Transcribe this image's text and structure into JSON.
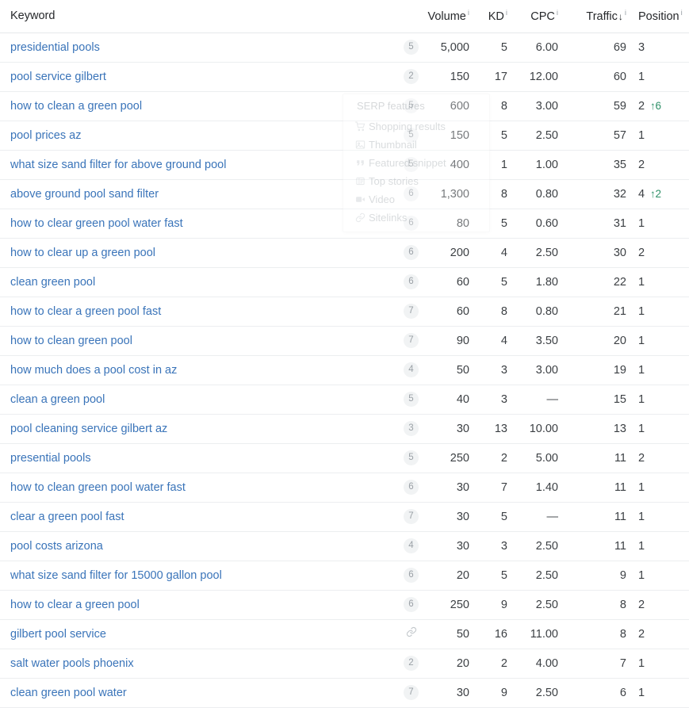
{
  "table": {
    "columns": [
      {
        "key": "keyword",
        "label": "Keyword",
        "info": false,
        "sort": ""
      },
      {
        "key": "badge",
        "label": "",
        "info": false,
        "sort": ""
      },
      {
        "key": "volume",
        "label": "Volume",
        "info": true,
        "sort": ""
      },
      {
        "key": "kd",
        "label": "KD",
        "info": true,
        "sort": ""
      },
      {
        "key": "cpc",
        "label": "CPC",
        "info": true,
        "sort": ""
      },
      {
        "key": "traffic",
        "label": "Traffic",
        "info": true,
        "sort": "↓"
      },
      {
        "key": "position",
        "label": "Position",
        "info": true,
        "sort": ""
      }
    ],
    "info_glyph": "i",
    "rows": [
      {
        "keyword": "presidential pools",
        "badge": "5",
        "badge_type": "count",
        "volume": "5,000",
        "kd": "5",
        "cpc": "6.00",
        "traffic": "69",
        "position": "3",
        "delta": ""
      },
      {
        "keyword": "pool service gilbert",
        "badge": "2",
        "badge_type": "count",
        "volume": "150",
        "kd": "17",
        "cpc": "12.00",
        "traffic": "60",
        "position": "1",
        "delta": ""
      },
      {
        "keyword": "how to clean a green pool",
        "badge": "5",
        "badge_type": "count",
        "volume": "600",
        "kd": "8",
        "cpc": "3.00",
        "traffic": "59",
        "position": "2",
        "delta": "↑6"
      },
      {
        "keyword": "pool prices az",
        "badge": "5",
        "badge_type": "count",
        "volume": "150",
        "kd": "5",
        "cpc": "2.50",
        "traffic": "57",
        "position": "1",
        "delta": ""
      },
      {
        "keyword": "what size sand filter for above ground pool",
        "badge": "5",
        "badge_type": "count",
        "volume": "400",
        "kd": "1",
        "cpc": "1.00",
        "traffic": "35",
        "position": "2",
        "delta": ""
      },
      {
        "keyword": "above ground pool sand filter",
        "badge": "6",
        "badge_type": "count",
        "volume": "1,300",
        "kd": "8",
        "cpc": "0.80",
        "traffic": "32",
        "position": "4",
        "delta": "↑2"
      },
      {
        "keyword": "how to clear green pool water fast",
        "badge": "6",
        "badge_type": "count",
        "volume": "80",
        "kd": "5",
        "cpc": "0.60",
        "traffic": "31",
        "position": "1",
        "delta": ""
      },
      {
        "keyword": "how to clear up a green pool",
        "badge": "6",
        "badge_type": "count",
        "volume": "200",
        "kd": "4",
        "cpc": "2.50",
        "traffic": "30",
        "position": "2",
        "delta": ""
      },
      {
        "keyword": "clean green pool",
        "badge": "6",
        "badge_type": "count",
        "volume": "60",
        "kd": "5",
        "cpc": "1.80",
        "traffic": "22",
        "position": "1",
        "delta": ""
      },
      {
        "keyword": "how to clear a green pool fast",
        "badge": "7",
        "badge_type": "count",
        "volume": "60",
        "kd": "8",
        "cpc": "0.80",
        "traffic": "21",
        "position": "1",
        "delta": ""
      },
      {
        "keyword": "how to clean green pool",
        "badge": "7",
        "badge_type": "count",
        "volume": "90",
        "kd": "4",
        "cpc": "3.50",
        "traffic": "20",
        "position": "1",
        "delta": ""
      },
      {
        "keyword": "how much does a pool cost in az",
        "badge": "4",
        "badge_type": "count",
        "volume": "50",
        "kd": "3",
        "cpc": "3.00",
        "traffic": "19",
        "position": "1",
        "delta": ""
      },
      {
        "keyword": "clean a green pool",
        "badge": "5",
        "badge_type": "count",
        "volume": "40",
        "kd": "3",
        "cpc": "—",
        "traffic": "15",
        "position": "1",
        "delta": ""
      },
      {
        "keyword": "pool cleaning service gilbert az",
        "badge": "3",
        "badge_type": "count",
        "volume": "30",
        "kd": "13",
        "cpc": "10.00",
        "traffic": "13",
        "position": "1",
        "delta": ""
      },
      {
        "keyword": "presential pools",
        "badge": "5",
        "badge_type": "count",
        "volume": "250",
        "kd": "2",
        "cpc": "5.00",
        "traffic": "11",
        "position": "2",
        "delta": ""
      },
      {
        "keyword": "how to clean green pool water fast",
        "badge": "6",
        "badge_type": "count",
        "volume": "30",
        "kd": "7",
        "cpc": "1.40",
        "traffic": "11",
        "position": "1",
        "delta": ""
      },
      {
        "keyword": "clear a green pool fast",
        "badge": "7",
        "badge_type": "count",
        "volume": "30",
        "kd": "5",
        "cpc": "—",
        "traffic": "11",
        "position": "1",
        "delta": ""
      },
      {
        "keyword": "pool costs arizona",
        "badge": "4",
        "badge_type": "count",
        "volume": "30",
        "kd": "3",
        "cpc": "2.50",
        "traffic": "11",
        "position": "1",
        "delta": ""
      },
      {
        "keyword": "what size sand filter for 15000 gallon pool",
        "badge": "6",
        "badge_type": "count",
        "volume": "20",
        "kd": "5",
        "cpc": "2.50",
        "traffic": "9",
        "position": "1",
        "delta": ""
      },
      {
        "keyword": "how to clear a green pool",
        "badge": "6",
        "badge_type": "count",
        "volume": "250",
        "kd": "9",
        "cpc": "2.50",
        "traffic": "8",
        "position": "2",
        "delta": ""
      },
      {
        "keyword": "gilbert pool service",
        "badge": "link",
        "badge_type": "link",
        "volume": "50",
        "kd": "16",
        "cpc": "11.00",
        "traffic": "8",
        "position": "2",
        "delta": ""
      },
      {
        "keyword": "salt water pools phoenix",
        "badge": "2",
        "badge_type": "count",
        "volume": "20",
        "kd": "2",
        "cpc": "4.00",
        "traffic": "7",
        "position": "1",
        "delta": ""
      },
      {
        "keyword": "clean green pool water",
        "badge": "7",
        "badge_type": "count",
        "volume": "30",
        "kd": "9",
        "cpc": "2.50",
        "traffic": "6",
        "position": "1",
        "delta": ""
      }
    ]
  },
  "serp_tooltip": {
    "title": "SERP features",
    "features": [
      {
        "icon": "shopping-cart-icon",
        "label": "Shopping results"
      },
      {
        "icon": "thumbnail-icon",
        "label": "Thumbnail"
      },
      {
        "icon": "featured-snippet-icon",
        "label": "Featured snippet"
      },
      {
        "icon": "top-stories-icon",
        "label": "Top stories"
      },
      {
        "icon": "video-icon",
        "label": "Video"
      },
      {
        "icon": "sitelinks-icon",
        "label": "Sitelinks"
      }
    ]
  },
  "colors": {
    "link": "#3a74b9",
    "delta_up": "#2e9068",
    "badge_bg": "#f1f3f4",
    "badge_text": "#9aa0a6",
    "row_border": "#eceef0",
    "header_text": "#26282b"
  }
}
